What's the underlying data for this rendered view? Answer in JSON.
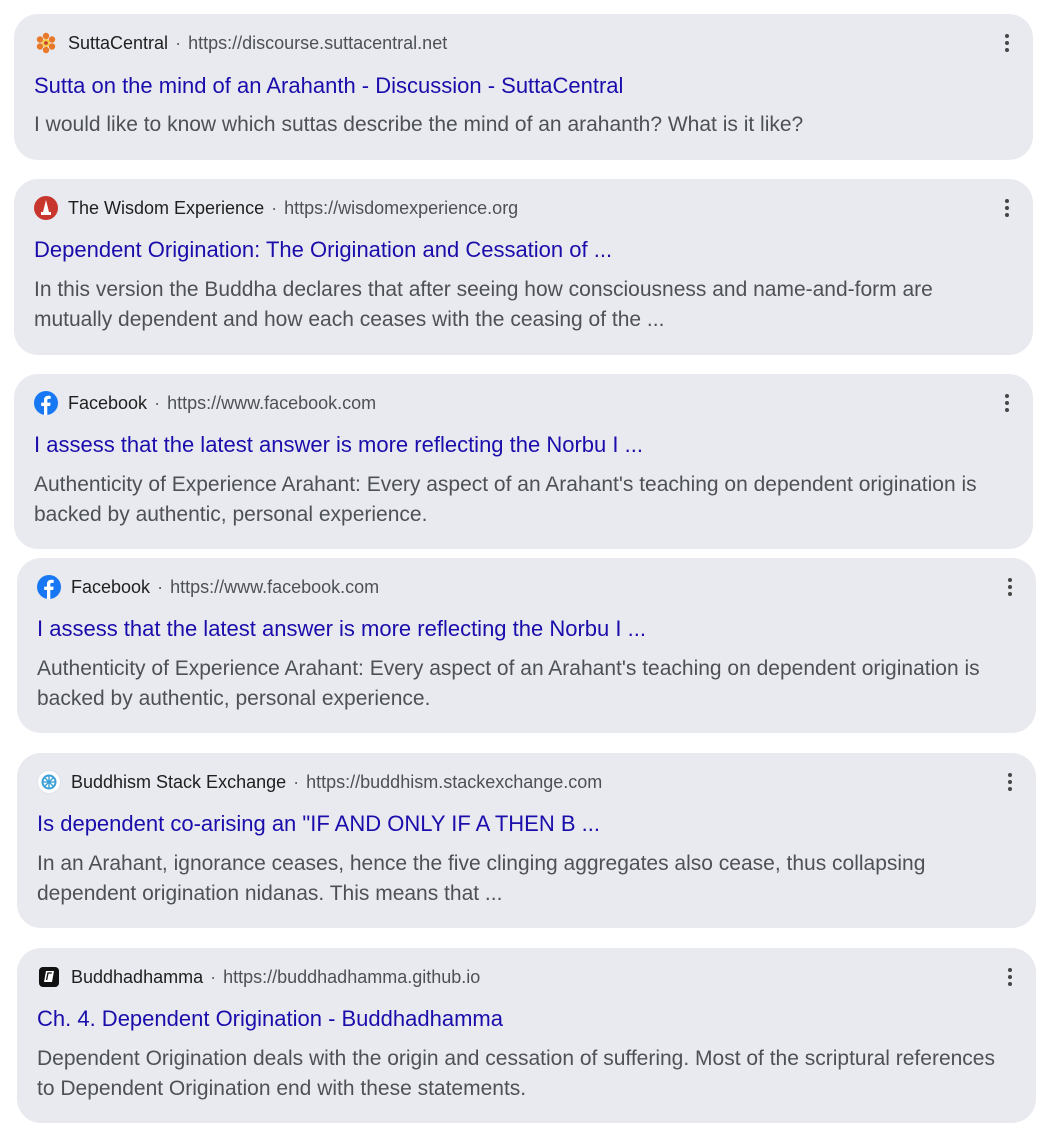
{
  "results": [
    {
      "site": "SuttaCentral",
      "separator": "·",
      "url": "https://discourse.suttacentral.net",
      "title": "Sutta on the mind of an Arahanth - Discussion - SuttaCentral",
      "snippet": "I would like to know which suttas describe the mind of an arahanth? What is it like?",
      "icon": "suttacentral-flower-icon"
    },
    {
      "site": "The Wisdom Experience",
      "separator": "·",
      "url": "https://wisdomexperience.org",
      "title": "Dependent Origination: The Origination and Cessation of ...",
      "snippet": "In this version the Buddha declares that after seeing how consciousness and name-and-form are mutually dependent and how each ceases with the ceasing of the ...",
      "icon": "wisdom-stupa-icon"
    },
    {
      "site": "Facebook",
      "separator": "·",
      "url": "https://www.facebook.com",
      "title": "I assess that the latest answer is more reflecting the Norbu I ...",
      "snippet": "Authenticity of Experience Arahant: Every aspect of an Arahant's teaching on dependent origination is backed by authentic, personal experience.",
      "icon": "facebook-icon"
    },
    {
      "site": "Facebook",
      "separator": "·",
      "url": "https://www.facebook.com",
      "title": "I assess that the latest answer is more reflecting the Norbu I ...",
      "snippet": "Authenticity of Experience Arahant: Every aspect of an Arahant's teaching on dependent origination is backed by authentic, personal experience.",
      "icon": "facebook-icon"
    },
    {
      "site": "Buddhism Stack Exchange",
      "separator": "·",
      "url": "https://buddhism.stackexchange.com",
      "title": "Is dependent co-arising an \"IF AND ONLY IF A THEN B ...",
      "snippet": "In an Arahant, ignorance ceases, hence the five clinging aggregates also cease, thus collapsing dependent origination nidanas. This means that ...",
      "icon": "stackexchange-dharma-wheel-icon"
    },
    {
      "site": "Buddhadhamma",
      "separator": "·",
      "url": "https://buddhadhamma.github.io",
      "title": "Ch. 4. Dependent Origination - Buddhadhamma",
      "snippet": "Dependent Origination deals with the origin and cessation of suffering. Most of the scriptural references to Dependent Origination end with these statements.",
      "icon": "buddhadhamma-book-icon"
    }
  ],
  "colors": {
    "card_bg": "#e9eaef",
    "title_link": "#1a0dab",
    "snippet_text": "#4d5156",
    "site_text": "#1f1f1f",
    "facebook_blue": "#1877f2",
    "wisdom_red": "#c8372d"
  }
}
